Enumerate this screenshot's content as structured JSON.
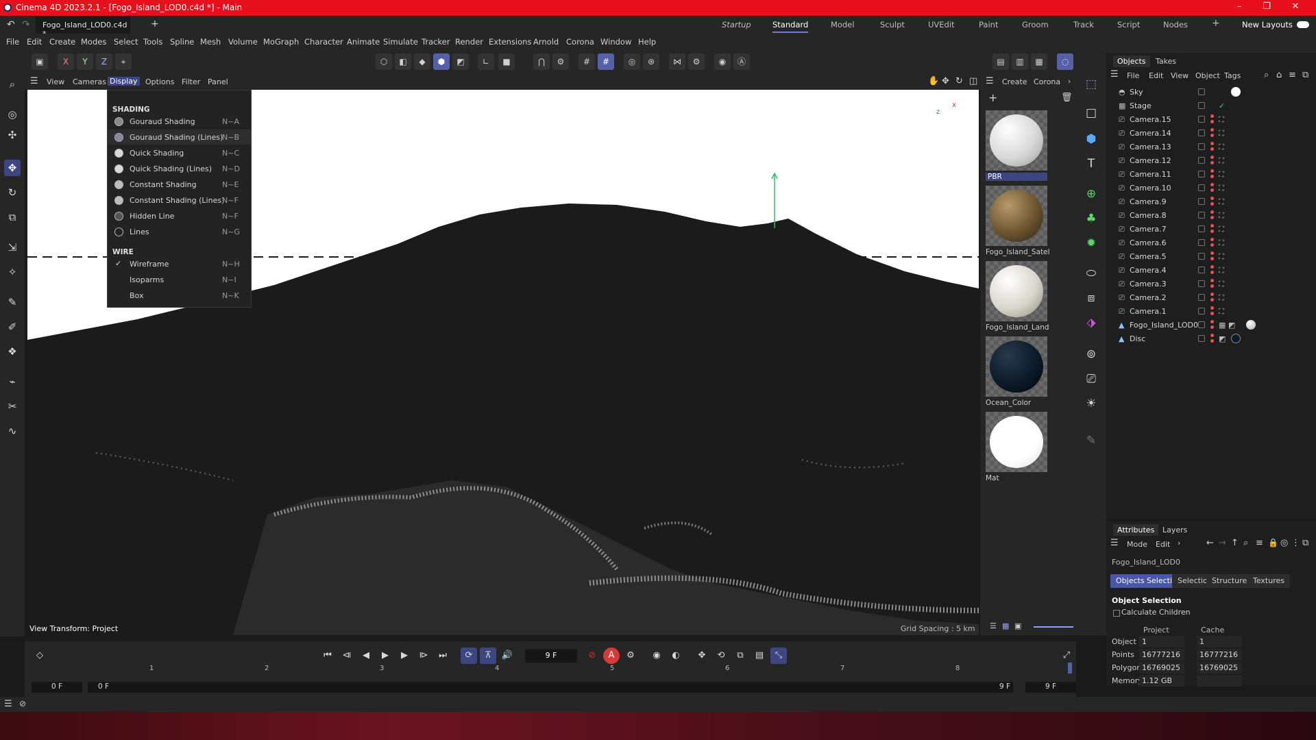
{
  "window": {
    "title": "Cinema 4D 2023.2.1 - [Fogo_Island_LOD0.c4d *] - Main"
  },
  "doc_tab": {
    "label": "Fogo_Island_LOD0.c4d *",
    "add": "+"
  },
  "layouts": {
    "items": [
      "Startup",
      "Standard",
      "Model",
      "Sculpt",
      "UVEdit",
      "Paint",
      "Groom",
      "Track",
      "Script",
      "Nodes"
    ],
    "new_layouts": "New Layouts",
    "plus": "+"
  },
  "menu": {
    "items": [
      "File",
      "Edit",
      "Create",
      "Modes",
      "Select",
      "Tools",
      "Spline",
      "Mesh",
      "Volume",
      "MoGraph",
      "Character",
      "Animate",
      "Simulate",
      "Tracker",
      "Render",
      "Extensions",
      "Arnold",
      "Corona",
      "Window",
      "Help"
    ]
  },
  "toolbar": {
    "x": "X",
    "y": "Y",
    "z": "Z"
  },
  "viewport_menu": {
    "items": [
      "View",
      "Cameras",
      "Display",
      "Options",
      "Filter",
      "Panel"
    ]
  },
  "display_menu": {
    "shading_header": "SHADING",
    "shading": [
      {
        "label": "Gouraud Shading",
        "shortcut": "N~A"
      },
      {
        "label": "Gouraud Shading (Lines)",
        "shortcut": "N~B"
      },
      {
        "label": "Quick Shading",
        "shortcut": "N~C"
      },
      {
        "label": "Quick Shading (Lines)",
        "shortcut": "N~D"
      },
      {
        "label": "Constant Shading",
        "shortcut": "N~E"
      },
      {
        "label": "Constant Shading (Lines)",
        "shortcut": "N~F"
      },
      {
        "label": "Hidden Line",
        "shortcut": "N~F"
      },
      {
        "label": "Lines",
        "shortcut": "N~G"
      }
    ],
    "wire_header": "WIRE",
    "wire": [
      {
        "label": "Wireframe",
        "shortcut": "N~H",
        "checked": "✓"
      },
      {
        "label": "Isoparms",
        "shortcut": "N~I"
      },
      {
        "label": "Box",
        "shortcut": "N~K"
      }
    ]
  },
  "viewport": {
    "view_transform": "View Transform: Project",
    "grid_spacing": "Grid Spacing : 5 km",
    "axis_x": "x",
    "axis_z": "z"
  },
  "materials_bar": {
    "create": "Create",
    "corona": "Corona"
  },
  "materials": [
    {
      "name": "PBR",
      "color": "#f0f0f0"
    },
    {
      "name": "Fogo_Island_Satel",
      "color": "#6b5530"
    },
    {
      "name": "Fogo_Island_Land",
      "color": "#d9d6cc"
    },
    {
      "name": "Ocean_Color",
      "color": "#0c1a2a"
    },
    {
      "name": "Mat",
      "color": "#ffffff"
    }
  ],
  "objects_panel": {
    "tabs": [
      "Objects",
      "Takes"
    ],
    "menu": [
      "File",
      "Edit",
      "View",
      "Object",
      "Tags"
    ],
    "items": [
      "Sky",
      "Stage",
      "Camera.15",
      "Camera.14",
      "Camera.13",
      "Camera.12",
      "Camera.11",
      "Camera.10",
      "Camera.9",
      "Camera.8",
      "Camera.7",
      "Camera.6",
      "Camera.5",
      "Camera.4",
      "Camera.3",
      "Camera.2",
      "Camera.1",
      "Fogo_Island_LOD0",
      "Disc"
    ]
  },
  "attributes": {
    "tabs": [
      "Attributes",
      "Layers"
    ],
    "menu": [
      "Mode",
      "Edit"
    ],
    "object_name": "Fogo_Island_LOD0",
    "subtabs": [
      "Objects Selection",
      "Selection",
      "Structure",
      "Textures"
    ],
    "section": "Object Selection",
    "calc_children": "Calculate Children",
    "col_project": "Project",
    "col_cache": "Cache",
    "rows": [
      {
        "label": "Object",
        "project": "1",
        "cache": "1"
      },
      {
        "label": "Points",
        "project": "16777216",
        "cache": "16777216"
      },
      {
        "label": "Polygons",
        "project": "16769025",
        "cache": "16769025"
      },
      {
        "label": "Memory",
        "project": "1.12 GB",
        "cache": ""
      }
    ]
  },
  "timeline": {
    "current_frame": "9 F",
    "ruler": [
      "1",
      "2",
      "3",
      "4",
      "5",
      "6",
      "7",
      "8"
    ],
    "start": "0 F",
    "range_start": "0 F",
    "range_end": "9 F",
    "end": "9 F",
    "record_label": "A"
  },
  "colors": {
    "accent": "#5561a6",
    "titlebar": "#e8101d"
  }
}
